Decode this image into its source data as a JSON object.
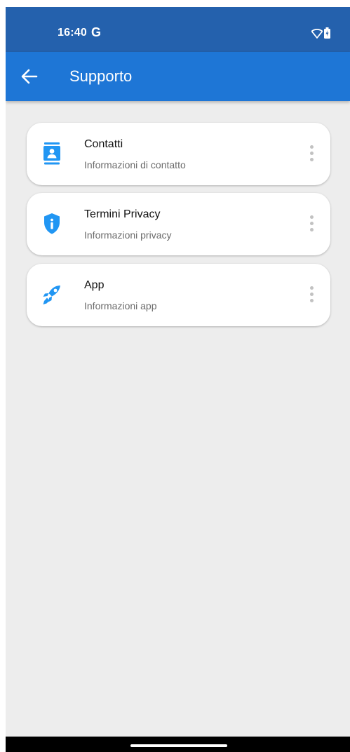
{
  "status_bar": {
    "time": "16:40",
    "carrier_badge": "G",
    "wifi_icon": "wifi-icon",
    "battery_icon": "battery-charging-icon"
  },
  "app_bar": {
    "title": "Supporto",
    "back_icon": "arrow-back-icon",
    "color": "#1e76d6"
  },
  "items": [
    {
      "title": "Contatti",
      "subtitle": "Informazioni di contatto",
      "icon": "contact-card-icon"
    },
    {
      "title": "Termini Privacy",
      "subtitle": "Informazioni privacy",
      "icon": "shield-info-icon"
    },
    {
      "title": "App",
      "subtitle": "Informazioni app",
      "icon": "rocket-icon"
    }
  ],
  "colors": {
    "status_bar": "#2461ad",
    "accent": "#2196f3",
    "background": "#ededed"
  }
}
